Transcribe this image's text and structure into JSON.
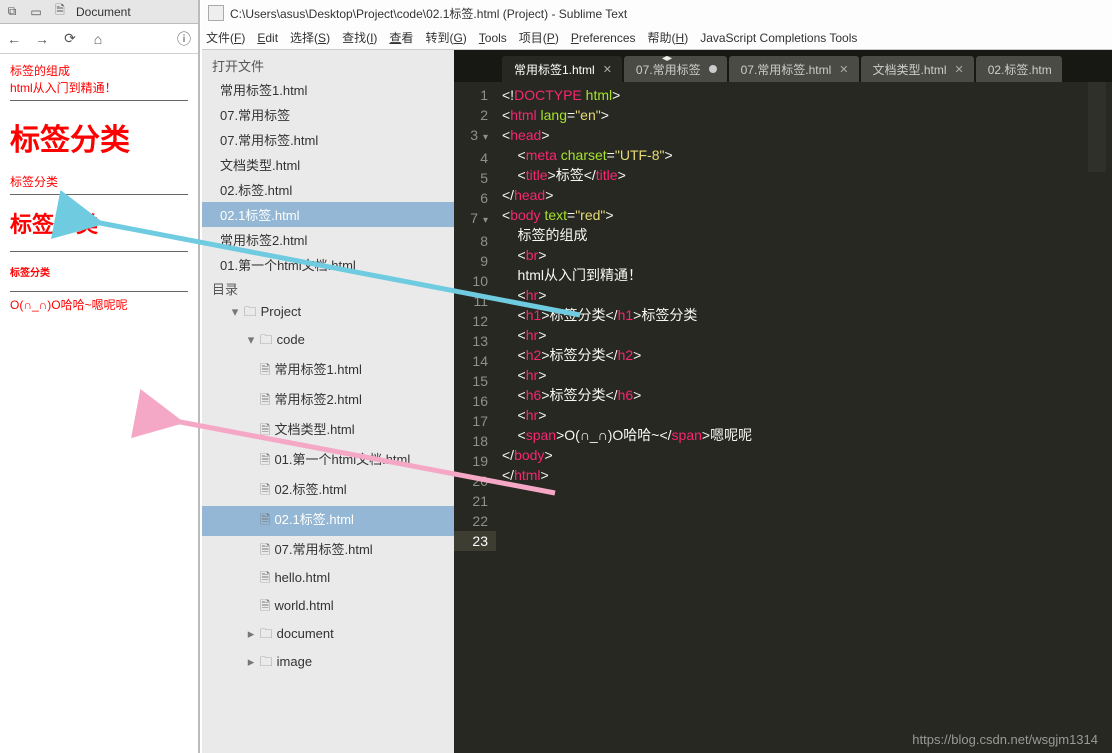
{
  "browser": {
    "tab_title": "Document",
    "render": {
      "line1": "标签的组成",
      "line2": "html从入门到精通！",
      "h1": "标签分类",
      "h1_after": "标签分类",
      "h2": "标签分类",
      "h6": "标签分类",
      "span": "O(∩_∩)O哈哈~嗯呢呢"
    }
  },
  "editor": {
    "title": "C:\\Users\\asus\\Desktop\\Project\\code\\02.1标签.html (Project) - Sublime Text",
    "menu": [
      "文件(F)",
      "Edit",
      "选择(S)",
      "查找(I)",
      "查看",
      "转到(G)",
      "Tools",
      "项目(P)",
      "Preferences",
      "帮助(H)",
      "JavaScript Completions Tools"
    ],
    "sidebar": {
      "open_files_label": "打开文件",
      "open_files": [
        "常用标签1.html",
        "07.常用标签",
        "07.常用标签.html",
        "文档类型.html",
        "02.标签.html",
        "02.1标签.html",
        "常用标签2.html",
        "01.第一个html文档.html"
      ],
      "open_selected": 5,
      "folders_label": "目录",
      "tree": [
        {
          "d": 1,
          "t": "dir",
          "open": true,
          "name": "Project"
        },
        {
          "d": 2,
          "t": "dir",
          "open": true,
          "name": "code"
        },
        {
          "d": 3,
          "t": "file",
          "name": "常用标签1.html"
        },
        {
          "d": 3,
          "t": "file",
          "name": "常用标签2.html"
        },
        {
          "d": 3,
          "t": "file",
          "name": "文档类型.html"
        },
        {
          "d": 3,
          "t": "file",
          "name": "01.第一个html文档.html"
        },
        {
          "d": 3,
          "t": "file",
          "name": "02.标签.html"
        },
        {
          "d": 3,
          "t": "file",
          "name": "02.1标签.html",
          "sel": true
        },
        {
          "d": 3,
          "t": "file",
          "name": "07.常用标签.html"
        },
        {
          "d": 3,
          "t": "file",
          "name": "hello.html"
        },
        {
          "d": 3,
          "t": "file",
          "name": "world.html"
        },
        {
          "d": 2,
          "t": "dir",
          "open": false,
          "name": "document"
        },
        {
          "d": 2,
          "t": "dir",
          "open": false,
          "name": "image"
        }
      ]
    },
    "tabs": [
      {
        "label": "常用标签1.html",
        "active": true,
        "close": true
      },
      {
        "label": "07.常用标签",
        "dirty": true
      },
      {
        "label": "07.常用标签.html",
        "close": true
      },
      {
        "label": "文档类型.html",
        "close": true
      },
      {
        "label": "02.标签.htm"
      }
    ],
    "code_lines": [
      [
        [
          "p",
          "<!"
        ],
        [
          "t",
          "DOCTYPE"
        ],
        [
          "p",
          " "
        ],
        [
          "a",
          "html"
        ],
        [
          "p",
          ">"
        ]
      ],
      [
        [
          "p",
          "<"
        ],
        [
          "t",
          "html"
        ],
        [
          "p",
          " "
        ],
        [
          "a",
          "lang"
        ],
        [
          "p",
          "="
        ],
        [
          "s",
          "\"en\""
        ],
        [
          "p",
          ">"
        ]
      ],
      [
        [
          "p",
          "<"
        ],
        [
          "t",
          "head"
        ],
        [
          "p",
          ">"
        ]
      ],
      [
        [
          "p",
          "    <"
        ],
        [
          "t",
          "meta"
        ],
        [
          "p",
          " "
        ],
        [
          "a",
          "charset"
        ],
        [
          "p",
          "="
        ],
        [
          "s",
          "\"UTF-8\""
        ],
        [
          "p",
          ">"
        ]
      ],
      [
        [
          "p",
          "    <"
        ],
        [
          "t",
          "title"
        ],
        [
          "p",
          ">标签</"
        ],
        [
          "t",
          "title"
        ],
        [
          "p",
          ">"
        ]
      ],
      [
        [
          "p",
          "</"
        ],
        [
          "t",
          "head"
        ],
        [
          "p",
          ">"
        ]
      ],
      [
        [
          "p",
          "<"
        ],
        [
          "t",
          "body"
        ],
        [
          "p",
          " "
        ],
        [
          "a",
          "text"
        ],
        [
          "p",
          "="
        ],
        [
          "s",
          "\"red\""
        ],
        [
          "p",
          ">"
        ]
      ],
      [
        [
          "p",
          "    标签的组成"
        ]
      ],
      [
        [
          "p",
          "    <"
        ],
        [
          "t",
          "br"
        ],
        [
          "p",
          ">"
        ]
      ],
      [
        [
          "p",
          "    html从入门到精通！"
        ]
      ],
      [
        [
          "p",
          "    <"
        ],
        [
          "t",
          "hr"
        ],
        [
          "p",
          ">"
        ]
      ],
      [
        [
          "p",
          "    <"
        ],
        [
          "t",
          "h1"
        ],
        [
          "p",
          ">标签分类</"
        ],
        [
          "t",
          "h1"
        ],
        [
          "p",
          ">标签分类"
        ]
      ],
      [
        [
          "p",
          "    <"
        ],
        [
          "t",
          "hr"
        ],
        [
          "p",
          ">"
        ]
      ],
      [
        [
          "p",
          ""
        ]
      ],
      [
        [
          "p",
          "    <"
        ],
        [
          "t",
          "h2"
        ],
        [
          "p",
          ">标签分类</"
        ],
        [
          "t",
          "h2"
        ],
        [
          "p",
          ">"
        ]
      ],
      [
        [
          "p",
          "    <"
        ],
        [
          "t",
          "hr"
        ],
        [
          "p",
          ">"
        ]
      ],
      [
        [
          "p",
          ""
        ]
      ],
      [
        [
          "p",
          "    <"
        ],
        [
          "t",
          "h6"
        ],
        [
          "p",
          ">标签分类</"
        ],
        [
          "t",
          "h6"
        ],
        [
          "p",
          ">"
        ]
      ],
      [
        [
          "p",
          "    <"
        ],
        [
          "t",
          "hr"
        ],
        [
          "p",
          ">"
        ]
      ],
      [
        [
          "p",
          ""
        ]
      ],
      [
        [
          "p",
          "    <"
        ],
        [
          "t",
          "span"
        ],
        [
          "p",
          ">O(∩_∩)O哈哈~</"
        ],
        [
          "t",
          "span"
        ],
        [
          "p",
          ">嗯呢呢"
        ]
      ],
      [
        [
          "p",
          "</"
        ],
        [
          "t",
          "body"
        ],
        [
          "p",
          ">"
        ]
      ],
      [
        [
          "p",
          "</"
        ],
        [
          "t",
          "html"
        ],
        [
          "p",
          ">"
        ]
      ]
    ],
    "fold_lines": [
      3,
      7
    ],
    "last_line_marked": 23
  },
  "watermark": "https://blog.csdn.net/wsgjm1314"
}
